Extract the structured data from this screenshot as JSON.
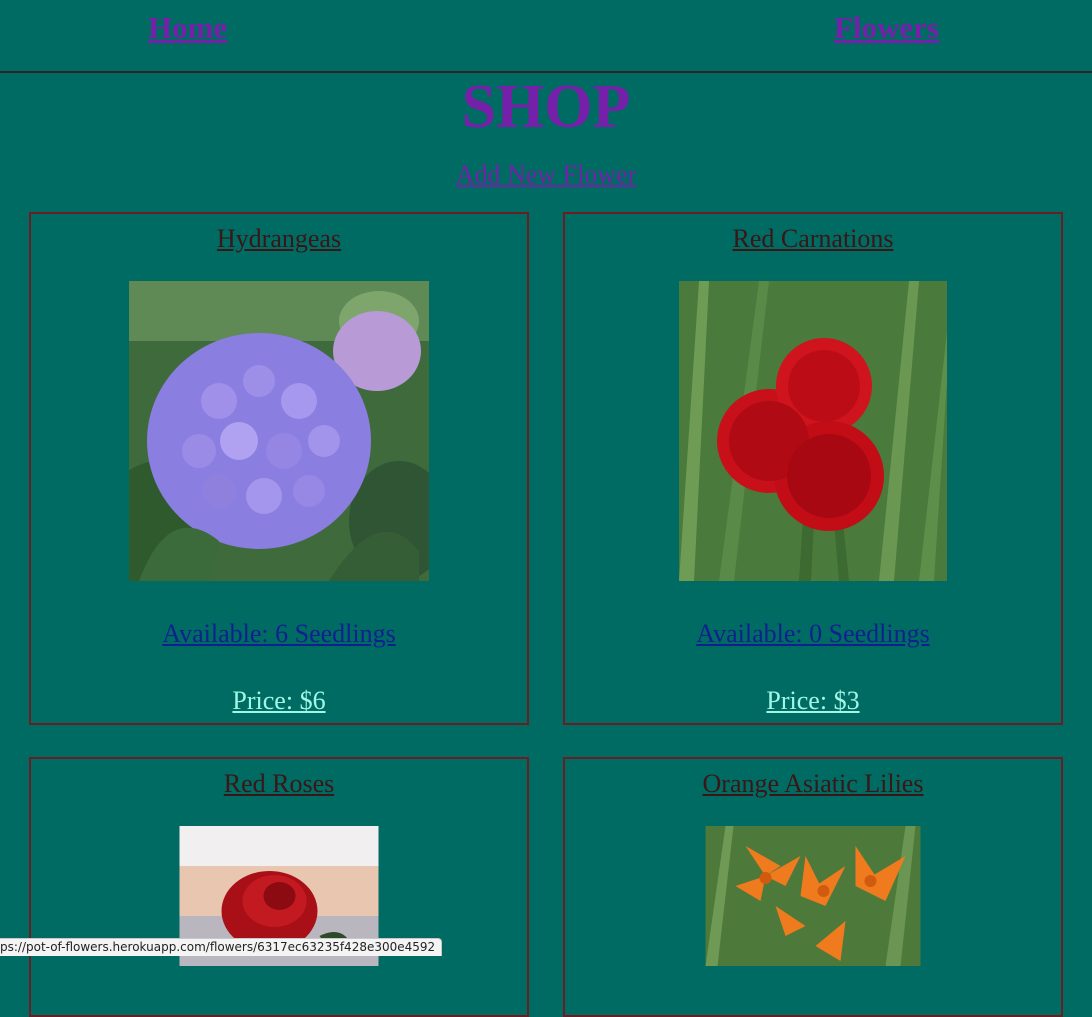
{
  "nav": {
    "home": "Home",
    "flowers": "Flowers"
  },
  "page": {
    "title": "SHOP",
    "add_link": "Add New Flower"
  },
  "flowers": [
    {
      "name": "Hydrangeas",
      "available": "Available: 6 Seedlings",
      "price": "Price: $6"
    },
    {
      "name": "Red Carnations",
      "available": "Available: 0 Seedlings",
      "price": "Price: $3"
    },
    {
      "name": "Red Roses"
    },
    {
      "name": "Orange Asiatic Lilies"
    }
  ],
  "status_bar": {
    "url": "ps://pot-of-flowers.herokuapp.com/flowers/6317ec63235f428e300e4592"
  }
}
